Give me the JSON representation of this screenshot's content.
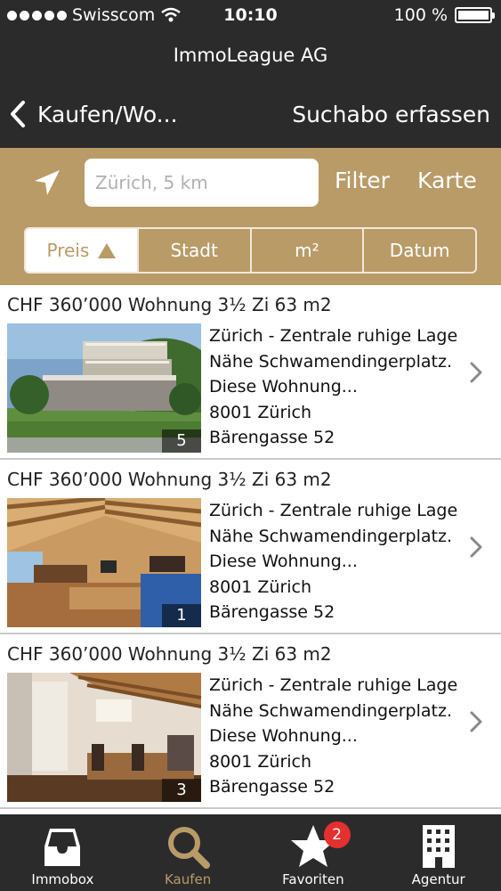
{
  "status_bar": {
    "carrier": "Swisscom",
    "time": "10:10",
    "battery": "100 %",
    "battery_level": 1.0
  },
  "header": {
    "title": "ImmoLeague AG",
    "back_label": "Kaufen/Wo...",
    "action_label": "Suchabo erfassen"
  },
  "search": {
    "placeholder": "Zürich, 5 km",
    "filter_label": "Filter",
    "map_label": "Karte"
  },
  "sort": {
    "options": [
      "Preis",
      "Stadt",
      "m²",
      "Datum"
    ],
    "active": "Preis"
  },
  "listings": [
    {
      "title": "CHF 360’000 Wohnung 3½ Zi 63 m2",
      "line1": "Zürich - Zentrale ruhige Lage",
      "line2": "Nähe Schwamendingerplatz.",
      "line3": "Diese Wohnung...",
      "zip_city": "8001 Zürich",
      "street": "Bärengasse 52",
      "photo_count": "5",
      "image": "building-exterior"
    },
    {
      "title": "CHF 360’000 Wohnung 3½ Zi 63 m2",
      "line1": "Zürich - Zentrale ruhige Lage",
      "line2": "Nähe Schwamendingerplatz.",
      "line3": "Diese Wohnung...",
      "zip_city": "8001 Zürich",
      "street": "Bärengasse 52",
      "photo_count": "1",
      "image": "attic-living-room"
    },
    {
      "title": "CHF 360’000 Wohnung 3½ Zi 63 m2",
      "line1": "Zürich - Zentrale ruhige Lage",
      "line2": "Nähe Schwamendingerplatz.",
      "line3": "Diese Wohnung...",
      "zip_city": "8001 Zürich",
      "street": "Bärengasse 52",
      "photo_count": "3",
      "image": "dining-room"
    }
  ],
  "tabs": [
    {
      "label": "Immobox",
      "icon": "inbox-icon"
    },
    {
      "label": "Kaufen",
      "icon": "search-icon",
      "active": true
    },
    {
      "label": "Favoriten",
      "icon": "star-icon",
      "badge": "2"
    },
    {
      "label": "Agentur",
      "icon": "building-icon"
    }
  ],
  "colors": {
    "accent": "#b99b68",
    "bar": "#2b2b2b",
    "badge": "#e53030"
  }
}
